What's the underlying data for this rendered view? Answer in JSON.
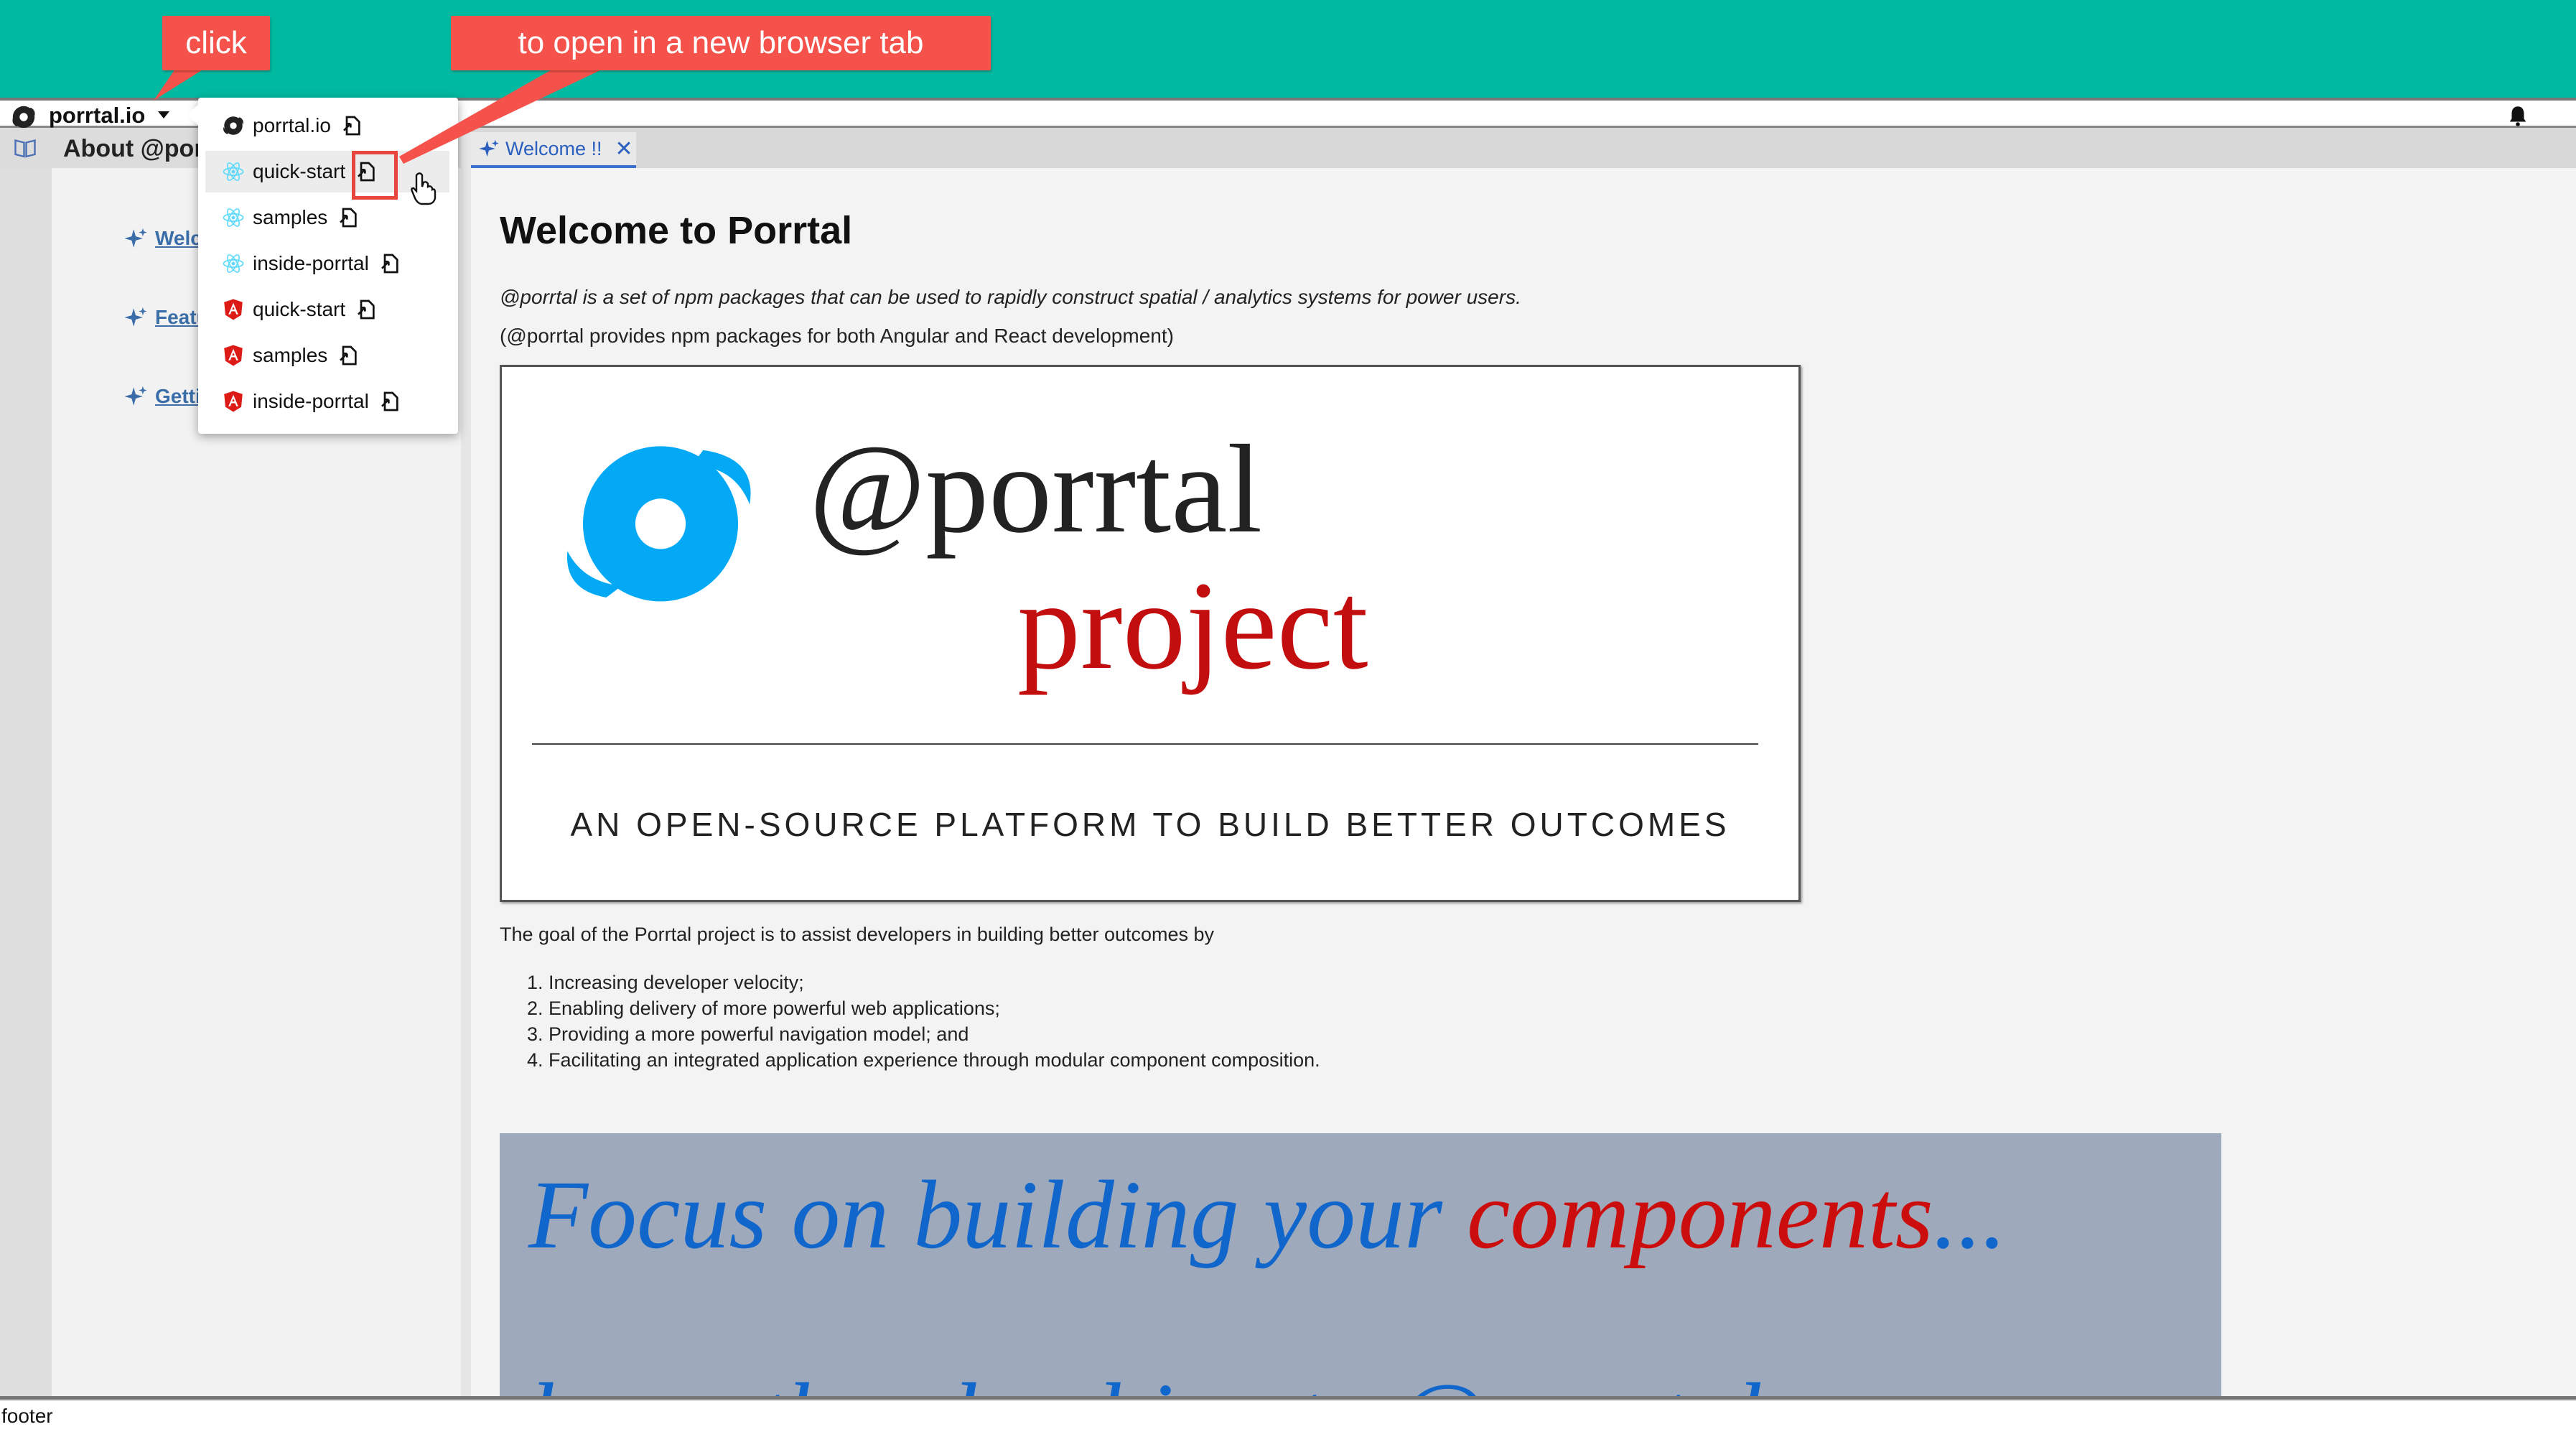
{
  "annotations": {
    "click": "click",
    "open_new_tab": "to open in a new browser tab"
  },
  "topbar": {
    "brand": "porrtal.io",
    "icons": [
      "porrtal-logo-icon",
      "chevron-down-icon",
      "bell-icon"
    ]
  },
  "dropdown": {
    "items": [
      {
        "label": "porrtal.io",
        "icon": "porrtal-logo-icon"
      },
      {
        "label": "quick-start",
        "icon": "react-icon"
      },
      {
        "label": "samples",
        "icon": "react-icon"
      },
      {
        "label": "inside-porrtal",
        "icon": "react-icon"
      },
      {
        "label": "quick-start",
        "icon": "angular-icon"
      },
      {
        "label": "samples",
        "icon": "angular-icon"
      },
      {
        "label": "inside-porrtal",
        "icon": "angular-icon"
      }
    ]
  },
  "sidebar": {
    "header": "About @por",
    "links": [
      "Welcome",
      "Features",
      "Getting St"
    ]
  },
  "tab": {
    "label": "Welcome !!",
    "close": "✕"
  },
  "main": {
    "title": "Welcome to Porrtal",
    "intro": "@porrtal is a set of npm packages that can be used to rapidly construct spatial / analytics systems for power users.",
    "intro2": "(@porrtal provides npm packages for both Angular and React development)",
    "banner": {
      "handle": "@porrtal",
      "word": "project",
      "tagline": "AN OPEN-SOURCE PLATFORM TO BUILD BETTER OUTCOMES"
    },
    "goal": "The goal of the Porrtal project is to assist developers in building better outcomes by",
    "goals": [
      "1. Increasing developer velocity;",
      "2. Enabling delivery of more powerful web applications;",
      "3. Providing a more powerful navigation model; and",
      "4. Facilitating an integrated application experience through modular component composition."
    ],
    "focus": {
      "part1": "Focus on building your ",
      "part2": "components",
      "part3": "...",
      "line2": "leave the plumbing to @porrtal"
    }
  },
  "footer": "footer",
  "colors": {
    "teal": "#00b9a1",
    "annotation_red": "#f4524a",
    "link_blue": "#3b6ea8",
    "react_blue": "#61dafb",
    "angular_red": "#dd1b16",
    "logo_blue": "#03a9f4",
    "project_red": "#c20e0e"
  }
}
